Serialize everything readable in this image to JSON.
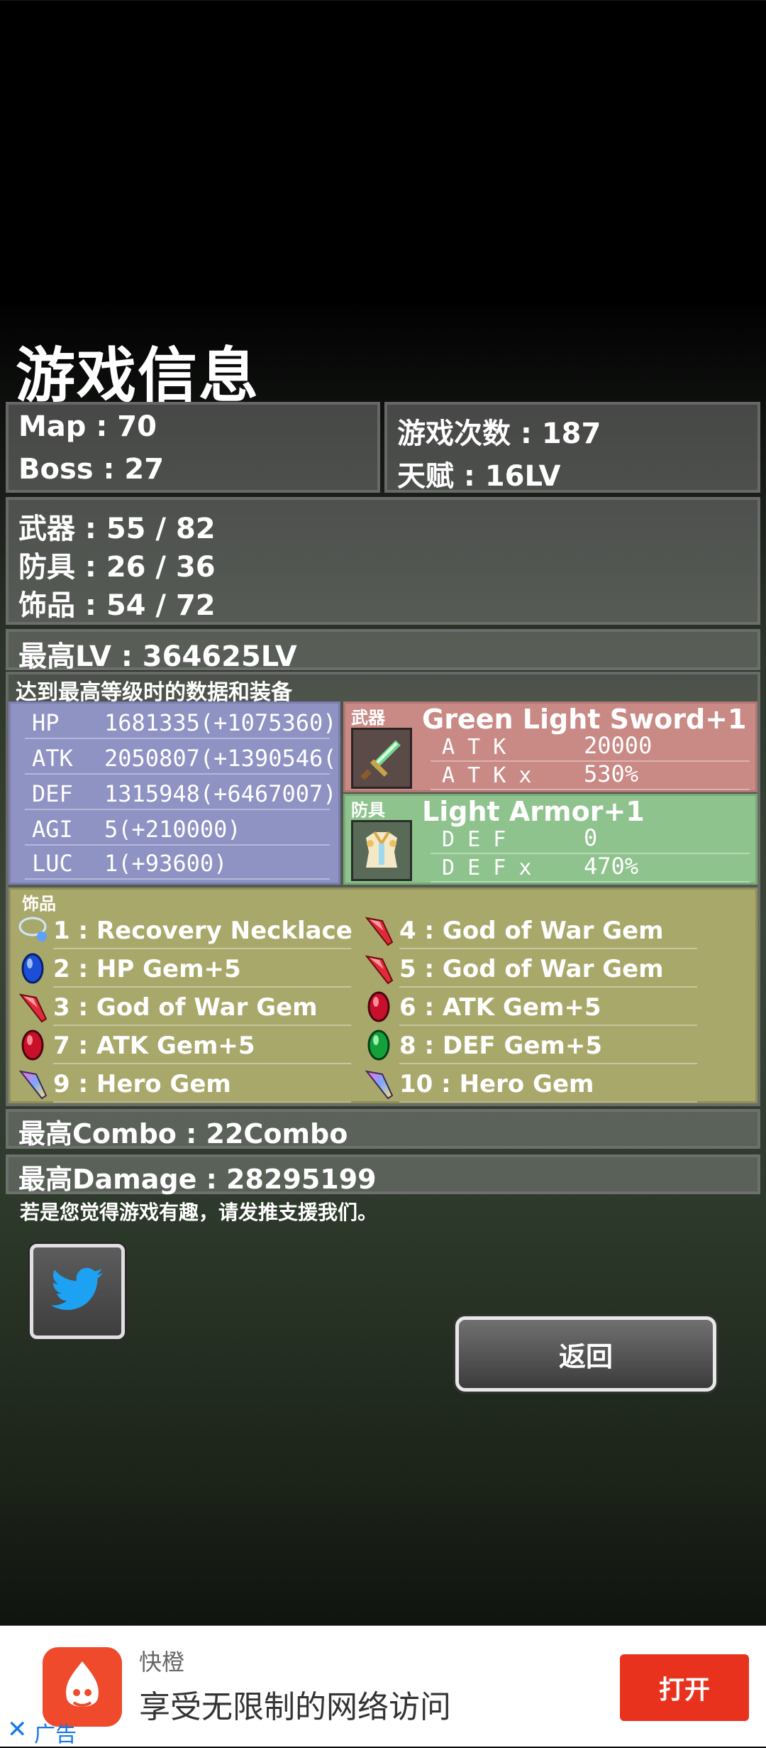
{
  "screen_title": "游戏信息",
  "stats_top": {
    "map": "Map : 70",
    "boss": "Boss : 27",
    "play_count": "游戏次数 : 187",
    "talent": "天赋 : 16LV"
  },
  "collection": {
    "weapons": "武器 : 55 / 82",
    "armor": "防具 : 26 / 36",
    "accessories": "饰品 : 54 / 72"
  },
  "max_lv": "最高LV : 364625LV",
  "snapshot_caption": "达到最高等级时的数据和装备",
  "character_stats": [
    {
      "name": "HP",
      "value": "1681335(+1075360)"
    },
    {
      "name": "ATK",
      "value": "2050807(+1390546("
    },
    {
      "name": "DEF",
      "value": "1315948(+6467007)"
    },
    {
      "name": "AGI",
      "value": "5(+210000)"
    },
    {
      "name": "LUC",
      "value": "1(+93600)"
    }
  ],
  "weapon": {
    "tag": "武器",
    "name": "Green Light Sword+1",
    "stat1_name": "A T K",
    "stat1_value": "20000",
    "stat2_name": "A T K  x",
    "stat2_value": "530%"
  },
  "armor": {
    "tag": "防具",
    "name": "Light Armor+1",
    "stat1_name": "D E F",
    "stat1_value": "0",
    "stat2_name": "D E F  x",
    "stat2_value": "470%"
  },
  "accessories_tag": "饰品",
  "accessories_left": [
    {
      "label": "1 : Recovery Necklace",
      "icon": "necklace-icon"
    },
    {
      "label": "2 : HP Gem+5",
      "icon": "blue-gem-icon"
    },
    {
      "label": "3 : God of War Gem",
      "icon": "red-crystal-icon"
    },
    {
      "label": "7 : ATK Gem+5",
      "icon": "red-gem-icon"
    },
    {
      "label": "9 : Hero Gem",
      "icon": "rainbow-crystal-icon"
    }
  ],
  "accessories_right": [
    {
      "label": "4 : God of War Gem",
      "icon": "red-crystal-icon"
    },
    {
      "label": "5 : God of War Gem",
      "icon": "red-crystal-icon"
    },
    {
      "label": "6 : ATK Gem+5",
      "icon": "red-gem-icon"
    },
    {
      "label": "8 : DEF Gem+5",
      "icon": "green-gem-icon"
    },
    {
      "label": "10 : Hero Gem",
      "icon": "rainbow-crystal-icon"
    }
  ],
  "max_combo": "最高Combo : 22Combo",
  "max_damage": "最高Damage : 28295199",
  "support_text": "若是您觉得游戏有趣，请发推支援我们。",
  "back_button": "返回",
  "ad": {
    "app_name": "快橙",
    "slogan": "享受无限制的网络访问",
    "open_button": "打开",
    "ad_label": "广告",
    "close": "✕"
  },
  "colors": {
    "weapon_bg": "#c98a86",
    "armor_bg": "#8fc38e",
    "stats_bg": "#8e93c4",
    "accessory_bg": "#a9a86b",
    "ad_button": "#e9321e",
    "twitter_blue": "#1da1f2"
  }
}
